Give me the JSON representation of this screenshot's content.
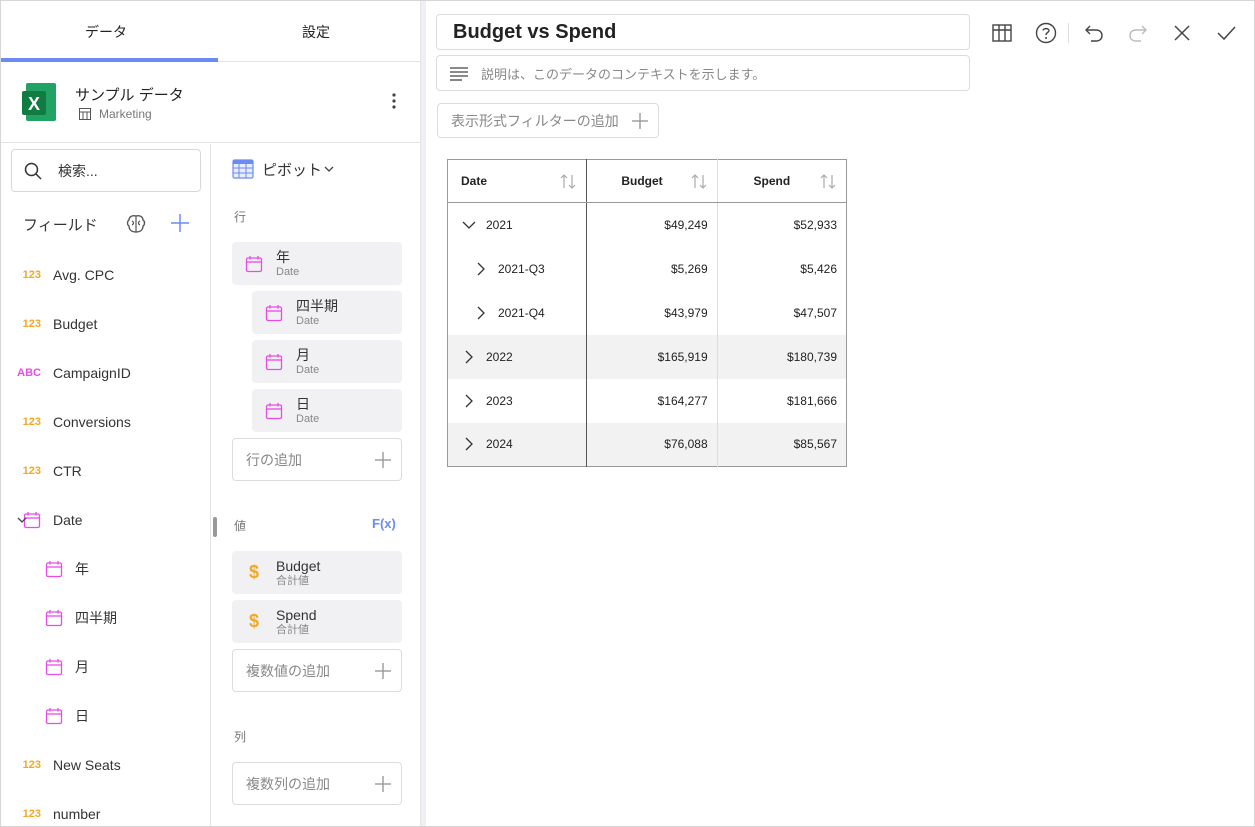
{
  "tabs": {
    "data": "データ",
    "settings": "設定"
  },
  "datasource": {
    "name": "サンプル データ",
    "sheet": "Marketing"
  },
  "search": {
    "placeholder": "検索..."
  },
  "fields": {
    "title": "フィールド",
    "items": [
      {
        "type": "123",
        "label": "Avg. CPC"
      },
      {
        "type": "123",
        "label": "Budget"
      },
      {
        "type": "ABC",
        "label": "CampaignID"
      },
      {
        "type": "123",
        "label": "Conversions"
      },
      {
        "type": "123",
        "label": "CTR"
      },
      {
        "type": "date",
        "label": "Date"
      },
      {
        "type": "date",
        "label": "年"
      },
      {
        "type": "date",
        "label": "四半期"
      },
      {
        "type": "date",
        "label": "月"
      },
      {
        "type": "date",
        "label": "日"
      },
      {
        "type": "123",
        "label": "New Seats"
      },
      {
        "type": "123",
        "label": "number"
      }
    ]
  },
  "pivot": {
    "selector": "ピボット",
    "rows_label": "行",
    "rows": [
      {
        "name": "年",
        "sub": "Date"
      },
      {
        "name": "四半期",
        "sub": "Date"
      },
      {
        "name": "月",
        "sub": "Date"
      },
      {
        "name": "日",
        "sub": "Date"
      }
    ],
    "add_row": "行の追加",
    "values_label": "値",
    "fx": "F(x)",
    "values": [
      {
        "name": "Budget",
        "sub": "合計値"
      },
      {
        "name": "Spend",
        "sub": "合計値"
      }
    ],
    "add_value": "複数値の追加",
    "columns_label": "列",
    "add_column": "複数列の追加"
  },
  "editor": {
    "title": "Budget vs Spend",
    "description_placeholder": "説明は、このデータのコンテキストを示します。",
    "filter_button": "表示形式フィルターの追加"
  },
  "grid": {
    "headers": [
      "Date",
      "Budget",
      "Spend"
    ],
    "rows": [
      {
        "label": "2021",
        "budget": "$49,249",
        "spend": "$52,933",
        "expanded": true
      },
      {
        "label": "2021-Q3",
        "budget": "$5,269",
        "spend": "$5,426"
      },
      {
        "label": "2021-Q4",
        "budget": "$43,979",
        "spend": "$47,507"
      },
      {
        "label": "2022",
        "budget": "$165,919",
        "spend": "$180,739"
      },
      {
        "label": "2023",
        "budget": "$164,277",
        "spend": "$181,666"
      },
      {
        "label": "2024",
        "budget": "$76,088",
        "spend": "$85,567"
      }
    ]
  },
  "colors": {
    "accent": "#6a8cf0",
    "number": "#f5a623",
    "text_type": "#e94ae9",
    "date": "#e94ae9",
    "excel": "#1f7a45"
  }
}
